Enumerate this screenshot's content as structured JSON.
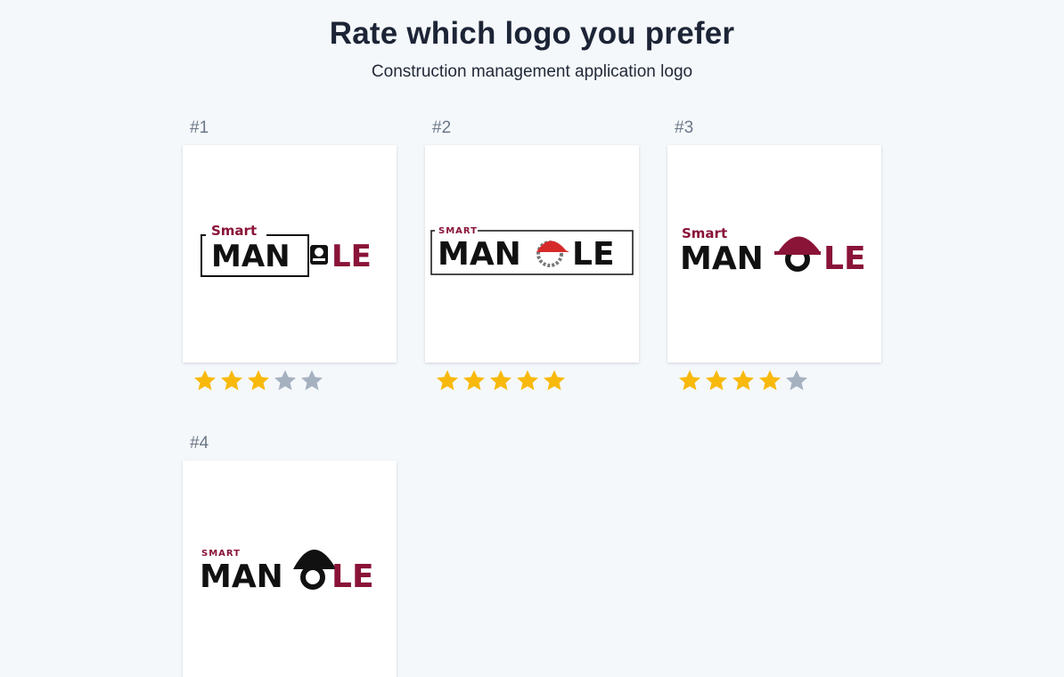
{
  "header": {
    "title": "Rate which logo you prefer",
    "subtitle": "Construction management application logo"
  },
  "entries": [
    {
      "number": "#1",
      "rating": 3,
      "max_rating": 5,
      "logo": {
        "small_text": "Smart",
        "left_text": "MAN",
        "right_text": "LE"
      }
    },
    {
      "number": "#2",
      "rating": 5,
      "max_rating": 5,
      "logo": {
        "small_text": "SMART",
        "left_text": "MAN",
        "right_text": "LE"
      }
    },
    {
      "number": "#3",
      "rating": 4,
      "max_rating": 5,
      "logo": {
        "small_text": "Smart",
        "left_text": "MAN",
        "right_text": "LE"
      }
    },
    {
      "number": "#4",
      "rating": null,
      "max_rating": 5,
      "logo": {
        "small_text": "SMART",
        "left_text": "MAN",
        "right_text": "LE"
      }
    }
  ],
  "colors": {
    "star_filled": "#f8b90c",
    "star_empty": "#a6b1c0",
    "brand_maroon": "#8a1338",
    "brand_red": "#d62a2a",
    "brand_dark": "#111111"
  },
  "icons": {
    "star": "star-icon",
    "helmet": "hard-hat-icon",
    "gear": "gear-icon",
    "lock": "padlock-icon"
  }
}
